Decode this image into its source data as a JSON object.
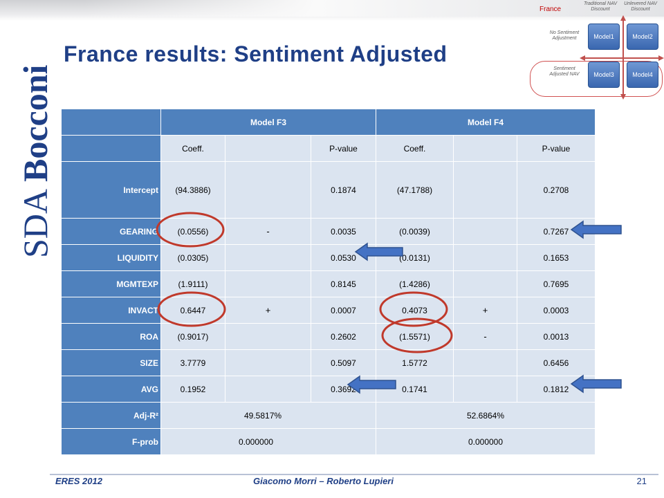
{
  "slide": {
    "title": "France results: Sentiment Adjusted",
    "brand_logo_text": "SDA Bocconi",
    "page_number": "21"
  },
  "mini_diagram": {
    "country": "France",
    "col1": "Traditional NAV Discount",
    "col2": "Unlevered NAV Discount",
    "row1": "No Sentiment Adjustment",
    "row2": "Sentiment Adjusted NAV",
    "models": [
      "Model1",
      "Model2",
      "Model3",
      "Model4"
    ],
    "accent_color": "#c00000"
  },
  "table": {
    "model_headers": [
      "Model F3",
      "Model F4"
    ],
    "coeff_label": "Coeff.",
    "pvalue_label": "P-value",
    "rows": [
      {
        "label": "Intercept",
        "f3_coeff": "(94.3886)",
        "f3_sign": "",
        "f3_p": "0.1874",
        "f4_coeff": "(47.1788)",
        "f4_sign": "",
        "f4_p": "0.2708"
      },
      {
        "label": "GEARING",
        "f3_coeff": "(0.0556)",
        "f3_sign": "-",
        "f3_p": "0.0035",
        "f4_coeff": "(0.0039)",
        "f4_sign": "",
        "f4_p": "0.7267"
      },
      {
        "label": "LIQUIDITY",
        "f3_coeff": "(0.0305)",
        "f3_sign": "",
        "f3_p": "0.0530",
        "f4_coeff": "(0.0131)",
        "f4_sign": "",
        "f4_p": "0.1653"
      },
      {
        "label": "MGMTEXP",
        "f3_coeff": "(1.9111)",
        "f3_sign": "",
        "f3_p": "0.8145",
        "f4_coeff": "(1.4286)",
        "f4_sign": "",
        "f4_p": "0.7695"
      },
      {
        "label": "INVACT",
        "f3_coeff": "0.6447",
        "f3_sign": "+",
        "f3_p": "0.0007",
        "f4_coeff": "0.4073",
        "f4_sign": "+",
        "f4_p": "0.0003"
      },
      {
        "label": "ROA",
        "f3_coeff": "(0.9017)",
        "f3_sign": "",
        "f3_p": "0.2602",
        "f4_coeff": "(1.5571)",
        "f4_sign": "-",
        "f4_p": "0.0013"
      },
      {
        "label": "SIZE",
        "f3_coeff": "3.7779",
        "f3_sign": "",
        "f3_p": "0.5097",
        "f4_coeff": "1.5772",
        "f4_sign": "",
        "f4_p": "0.6456"
      },
      {
        "label": "AVG",
        "f3_coeff": "0.1952",
        "f3_sign": "",
        "f3_p": "0.3692",
        "f4_coeff": "0.1741",
        "f4_sign": "",
        "f4_p": "0.1812"
      }
    ],
    "adj_r2": {
      "label": "Adj-R²",
      "f3": "49.5817%",
      "f4": "52.6864%"
    },
    "f_prob": {
      "label": "F-prob",
      "f3": "0.000000",
      "f4": "0.000000"
    }
  },
  "colors": {
    "header_blue": "#4f81bd",
    "cell_light": "#dbe4f0",
    "title_navy": "#1f3f86",
    "highlight_red": "#c0392b",
    "arrow_blue": "#4472c4"
  },
  "footer": {
    "left": "ERES 2012",
    "center": "Giacomo Morri – Roberto Lupieri"
  }
}
